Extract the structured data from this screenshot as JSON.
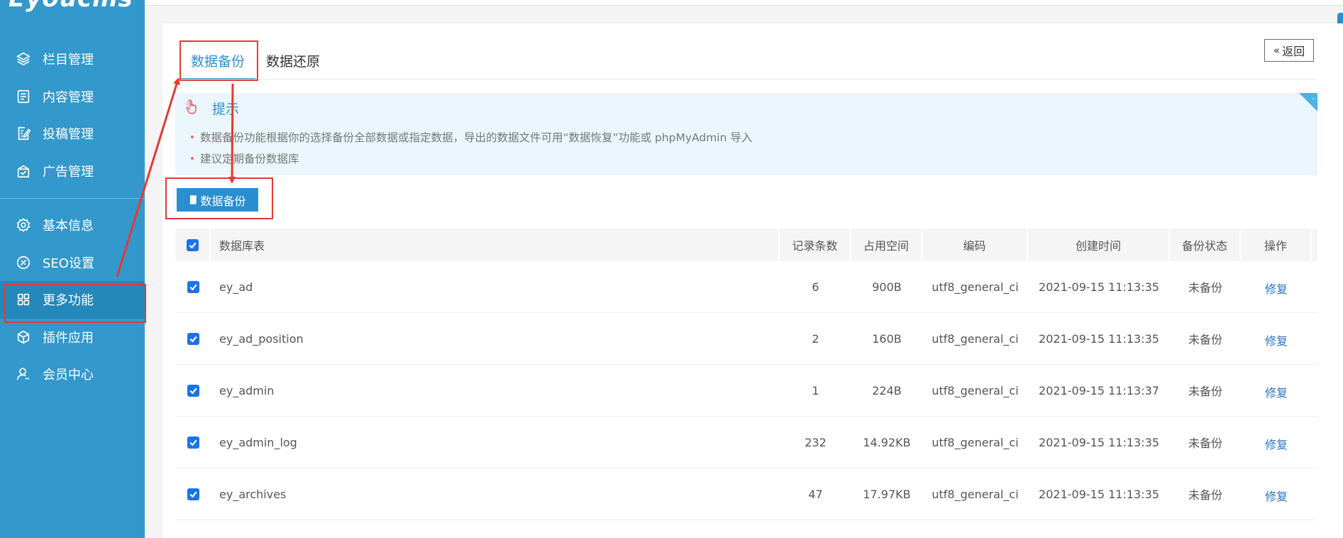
{
  "sidebar": {
    "logo": "Eyoucms",
    "items": [
      {
        "label": "栏目管理",
        "icon": "layers-icon"
      },
      {
        "label": "内容管理",
        "icon": "document-icon"
      },
      {
        "label": "投稿管理",
        "icon": "edit-document-icon"
      },
      {
        "label": "广告管理",
        "icon": "ad-box-icon"
      },
      {
        "label": "基本信息",
        "icon": "gear-icon"
      },
      {
        "label": "SEO设置",
        "icon": "seo-icon"
      },
      {
        "label": "更多功能",
        "icon": "grid-icon",
        "active": true
      },
      {
        "label": "插件应用",
        "icon": "cube-icon"
      },
      {
        "label": "会员中心",
        "icon": "user-icon"
      }
    ]
  },
  "tabs": [
    {
      "label": "数据备份",
      "active": true
    },
    {
      "label": "数据还原",
      "active": false
    }
  ],
  "back_label": "返回",
  "tip": {
    "title": "提示",
    "lines": [
      "数据备份功能根据你的选择备份全部数据或指定数据，导出的数据文件可用“数据恢复”功能或 phpMyAdmin 导入",
      "建议定期备份数据库"
    ],
    "corner_label": "-"
  },
  "backup_button_label": "数据备份",
  "table": {
    "headers": [
      "数据库表",
      "记录条数",
      "占用空间",
      "编码",
      "创建时间",
      "备份状态",
      "操作"
    ],
    "rows": [
      {
        "name": "ey_ad",
        "records": "6",
        "size": "900B",
        "encoding": "utf8_general_ci",
        "created": "2021-09-15 11:13:35",
        "status": "未备份",
        "action": "修复"
      },
      {
        "name": "ey_ad_position",
        "records": "2",
        "size": "160B",
        "encoding": "utf8_general_ci",
        "created": "2021-09-15 11:13:35",
        "status": "未备份",
        "action": "修复"
      },
      {
        "name": "ey_admin",
        "records": "1",
        "size": "224B",
        "encoding": "utf8_general_ci",
        "created": "2021-09-15 11:13:37",
        "status": "未备份",
        "action": "修复"
      },
      {
        "name": "ey_admin_log",
        "records": "232",
        "size": "14.92KB",
        "encoding": "utf8_general_ci",
        "created": "2021-09-15 11:13:35",
        "status": "未备份",
        "action": "修复"
      },
      {
        "name": "ey_archives",
        "records": "47",
        "size": "17.97KB",
        "encoding": "utf8_general_ci",
        "created": "2021-09-15 11:13:35",
        "status": "未备份",
        "action": "修复"
      }
    ]
  },
  "colors": {
    "sidebar": "#3398cc",
    "sidebar_active": "#2588bb",
    "accent": "#2a91d2",
    "annotation": "#e53935"
  }
}
